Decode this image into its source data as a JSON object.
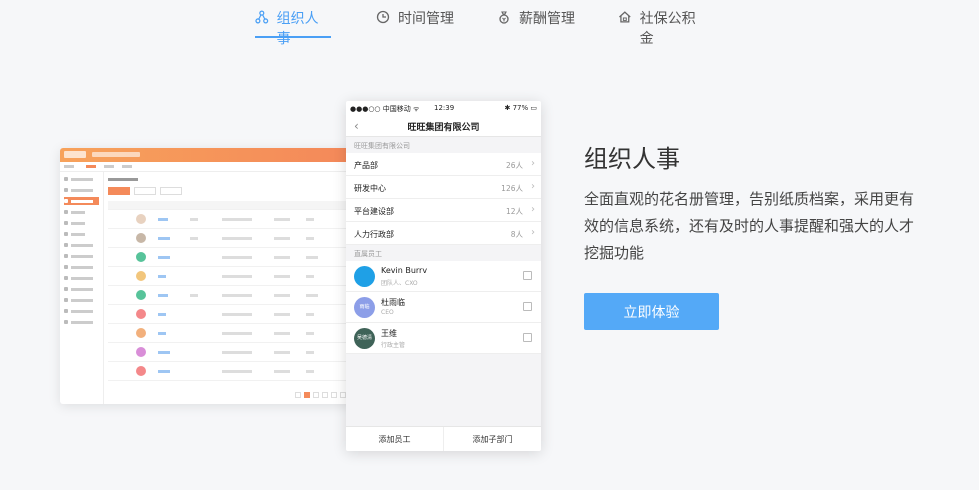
{
  "tabs": [
    {
      "label": "组织人事",
      "icon": "org-chart-icon",
      "active": true
    },
    {
      "label": "时间管理",
      "icon": "clock-icon",
      "active": false
    },
    {
      "label": "薪酬管理",
      "icon": "money-bag-icon",
      "active": false
    },
    {
      "label": "社保公积金",
      "icon": "house-icon",
      "active": false
    }
  ],
  "phone": {
    "status": {
      "carrier": "●●●○○ 中国移动 ᯤ",
      "time": "12:39",
      "battery": "✱ 77% ▭"
    },
    "title": "旺旺集团有限公司",
    "company_section": "旺旺集团有限公司",
    "departments": [
      {
        "name": "产品部",
        "count": "26人"
      },
      {
        "name": "研发中心",
        "count": "126人"
      },
      {
        "name": "平台建设部",
        "count": "12人"
      },
      {
        "name": "人力行政部",
        "count": "8人"
      }
    ],
    "employee_section": "直属员工",
    "employees": [
      {
        "name": "Kevin Burrv",
        "role": "团队人、CXO",
        "avatar": "",
        "color": "#1fa0e6"
      },
      {
        "name": "杜雨临",
        "role": "CEO",
        "avatar": "雨临",
        "color": "#8c9ee8"
      },
      {
        "name": "王维",
        "role": "行政主管",
        "avatar": "吴德清",
        "color": "#3f6358"
      }
    ],
    "bottom": {
      "add_employee": "添加员工",
      "add_subdept": "添加子部门"
    }
  },
  "content": {
    "heading": "组织人事",
    "description": "全面直观的花名册管理，告别纸质档案，采用更有效的信息系统，还有及时的人事提醒和强大的人才挖掘功能",
    "cta": "立即体验"
  },
  "colors": {
    "accent": "#4a9ff5",
    "button": "#54a9f7",
    "desktop_header": "#f48a5a"
  }
}
